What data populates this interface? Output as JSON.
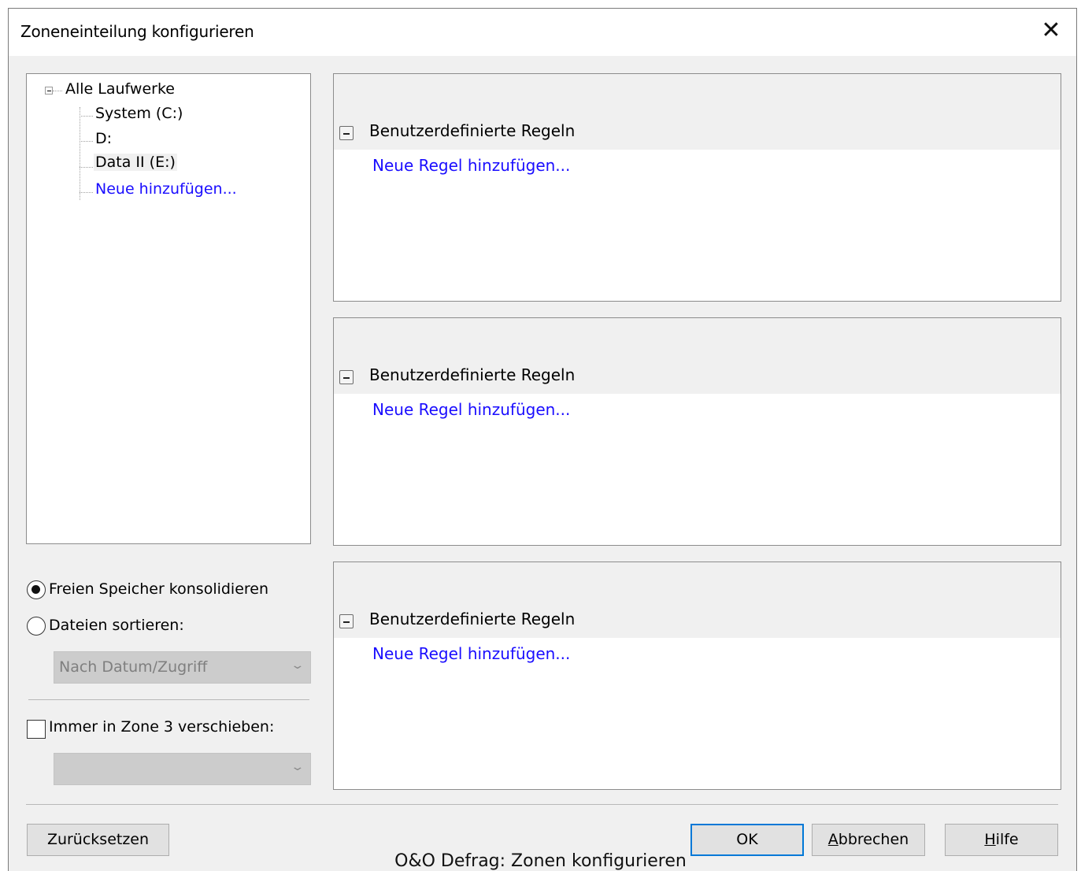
{
  "window": {
    "title": "Zoneneinteilung konfigurieren",
    "close_symbol": "✕"
  },
  "tree": {
    "root": "Alle Laufwerke",
    "items": [
      "System (C:)",
      "D:",
      "Data II (E:)"
    ],
    "add_link": "Neue hinzufügen..."
  },
  "panels": [
    {
      "header": "Benutzerdefinierte Regeln",
      "link": "Neue Regel hinzufügen..."
    },
    {
      "header": "Benutzerdefinierte Regeln",
      "link": "Neue Regel hinzufügen..."
    },
    {
      "header": "Benutzerdefinierte Regeln",
      "link": "Neue Regel hinzufügen..."
    }
  ],
  "options": {
    "consolidate": {
      "label": "Freien Speicher konsolidieren",
      "checked": true
    },
    "sort": {
      "label": "Dateien sortieren:",
      "checked": false
    },
    "sort_select": {
      "value": "Nach Datum/Zugriff",
      "disabled": true
    },
    "move_zone3": {
      "label": "Immer in Zone 3 verschieben:",
      "checked": false
    },
    "zone3_select": {
      "value": "",
      "disabled": true
    }
  },
  "buttons": {
    "reset": "Zurücksetzen",
    "ok": "OK",
    "cancel": {
      "accel": "A",
      "rest": "bbrechen"
    },
    "help": {
      "accel": "H",
      "rest": "ilfe"
    }
  },
  "caption": "O&O Defrag: Zonen konfigurieren",
  "colors": {
    "link": "#1a0dff",
    "default_button_border": "#0078d7",
    "dialog_bg": "#f0f0f0"
  }
}
